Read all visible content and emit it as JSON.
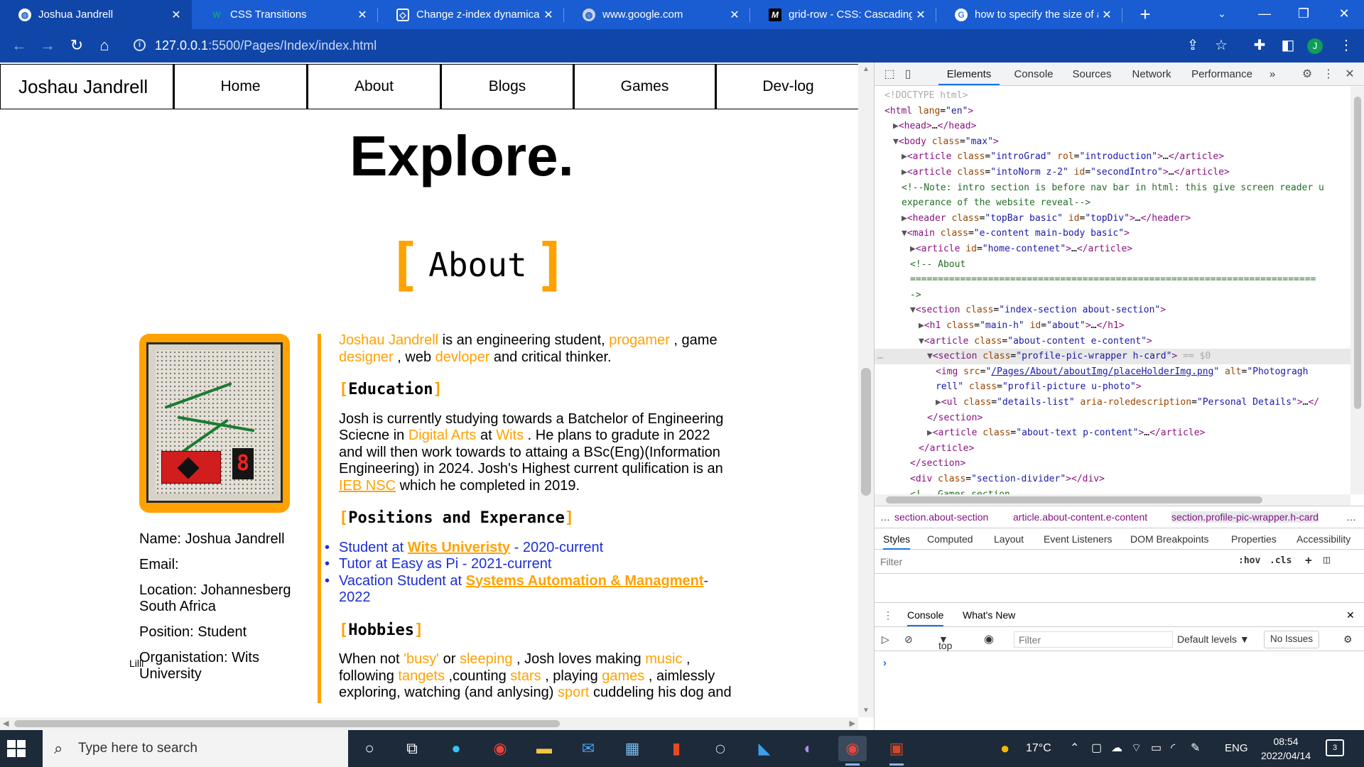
{
  "browser": {
    "tabs": [
      {
        "title": "Joshua Jandrell",
        "icon": "globe-icon",
        "active": true
      },
      {
        "title": "CSS Transitions",
        "icon": "w3schools-icon",
        "active": false
      },
      {
        "title": "Change z-index dynamically",
        "icon": "codepen-icon",
        "active": false
      },
      {
        "title": "www.google.com",
        "icon": "globe-icon",
        "active": false
      },
      {
        "title": "grid-row - CSS: Cascading S",
        "icon": "mdn-icon",
        "active": false
      },
      {
        "title": "how to specify the size of a",
        "icon": "google-icon",
        "active": false
      }
    ],
    "url_host": "127.0.0.1",
    "url_path": ":5500/Pages/Index/index.html",
    "profile_initial": "J"
  },
  "site": {
    "brand": "Joshau Jandrell",
    "nav": [
      "Home",
      "About",
      "Blogs",
      "Games",
      "Dev-log"
    ],
    "hero": "Explore.",
    "section_title": "About",
    "photo_digit": "8",
    "details": [
      "Name: Joshua Jandrell",
      "Email:",
      "Location: Johannesberg South Africa",
      "Position: Student",
      "Organistation: Wits University"
    ],
    "details_cut": "Lilli",
    "intro": {
      "name": "Joshau Jandrell",
      "t1": " is an engineering student, ",
      "w1": "progamer",
      "t2": " , game ",
      "w2": "designer",
      "t3": " , web ",
      "w3": "devloper",
      "t4": " and critical thinker."
    },
    "education_heading": "Education",
    "education": {
      "t1": "Josh is currently studying towards a Batchelor of Engineering Sciecne in ",
      "w1": "Digital Arts",
      "t2": " at ",
      "w2": "Wits",
      "t3": " . He plans to gradute in 2022 and will then work towards to attaing a BSc(Eng)(Information Engineering) in 2024. Josh's Highest current qulification is an ",
      "link": "IEB NSC",
      "t4": " which he completed in 2019."
    },
    "positions_heading": "Positions and Experance",
    "positions": [
      {
        "pre": "Student at ",
        "link": "Wits Univeristy",
        "post": " - 2020-current"
      },
      {
        "pre": "Tutor at Easy as Pi - 2021-current",
        "link": "",
        "post": ""
      },
      {
        "pre": "Vacation Student at ",
        "link": "Systems Automation & Managment",
        "post": "- 2022"
      }
    ],
    "hobbies_heading": "Hobbies",
    "hobbies": {
      "t1": "When not ",
      "w1": "'busy'",
      "t2": " or ",
      "w2": "sleeping",
      "t3": " , Josh loves making ",
      "w3": "music",
      "t4": " , following ",
      "w4": "tangets",
      "t5": " ,counting ",
      "w5": "stars",
      "t6": " , playing ",
      "w6": "games",
      "t7": " , aimlessly exploring, watching (and anlysing) ",
      "w7": "sport",
      "t8": " cuddeling his dog and"
    }
  },
  "devtools": {
    "tabs": [
      "Elements",
      "Console",
      "Sources",
      "Network",
      "Performance"
    ],
    "more": "»",
    "dom_lines": [
      {
        "i": 0,
        "tri": "",
        "html": "<span class=\"dc\">&lt;!DOCTYPE html&gt;</span>"
      },
      {
        "i": 0,
        "tri": "",
        "html": "<span class=\"tg\">&lt;html</span> <span class=\"an\">lang</span>=<span class=\"av\">\"en\"</span><span class=\"tg\">&gt;</span>"
      },
      {
        "i": 1,
        "tri": "▶",
        "html": "<span class=\"tg\">&lt;head&gt;</span>…<span class=\"tg\">&lt;/head&gt;</span>"
      },
      {
        "i": 1,
        "tri": "▼",
        "html": "<span class=\"tg\">&lt;body</span> <span class=\"an\">class</span>=<span class=\"av\">\"max\"</span><span class=\"tg\">&gt;</span>"
      },
      {
        "i": 2,
        "tri": "▶",
        "html": "<span class=\"tg\">&lt;article</span> <span class=\"an\">class</span>=<span class=\"av\">\"introGrad\"</span> <span class=\"an\">rol</span>=<span class=\"av\">\"introduction\"</span><span class=\"tg\">&gt;</span>…<span class=\"tg\">&lt;/article&gt;</span>"
      },
      {
        "i": 2,
        "tri": "▶",
        "html": "<span class=\"tg\">&lt;article</span> <span class=\"an\">class</span>=<span class=\"av\">\"intoNorm z-2\"</span> <span class=\"an\">id</span>=<span class=\"av\">\"secondIntro\"</span><span class=\"tg\">&gt;</span>…<span class=\"tg\">&lt;/article&gt;</span>"
      },
      {
        "i": 2,
        "tri": "",
        "html": "<span class=\"cm\">&lt;!--Note: intro section is before nav bar in html: this give screen reader u</span>"
      },
      {
        "i": 2,
        "tri": "",
        "html": "<span class=\"cm\">experance of the website reveal--&gt;</span>"
      },
      {
        "i": 2,
        "tri": "▶",
        "html": "<span class=\"tg\">&lt;header</span> <span class=\"an\">class</span>=<span class=\"av\">\"topBar basic\"</span> <span class=\"an\">id</span>=<span class=\"av\">\"topDiv\"</span><span class=\"tg\">&gt;</span>…<span class=\"tg\">&lt;/header&gt;</span>"
      },
      {
        "i": 2,
        "tri": "▼",
        "html": "<span class=\"tg\">&lt;main</span> <span class=\"an\">class</span>=<span class=\"av\">\"e-content main-body basic\"</span><span class=\"tg\">&gt;</span>"
      },
      {
        "i": 3,
        "tri": "▶",
        "html": "<span class=\"tg\">&lt;article</span> <span class=\"an\">id</span>=<span class=\"av\">\"home-contenet\"</span><span class=\"tg\">&gt;</span>…<span class=\"tg\">&lt;/article&gt;</span>"
      },
      {
        "i": 3,
        "tri": "",
        "html": "<span class=\"cm\">&lt;!-- About</span>"
      },
      {
        "i": 3,
        "tri": "",
        "html": "<span class=\"cm\">=========================================================================</span>"
      },
      {
        "i": 3,
        "tri": "",
        "html": "<span class=\"cm\">-&gt;</span>"
      },
      {
        "i": 3,
        "tri": "▼",
        "html": "<span class=\"tg\">&lt;section</span> <span class=\"an\">class</span>=<span class=\"av\">\"index-section about-section\"</span><span class=\"tg\">&gt;</span>"
      },
      {
        "i": 4,
        "tri": "▶",
        "html": "<span class=\"tg\">&lt;h1</span> <span class=\"an\">class</span>=<span class=\"av\">\"main-h\"</span> <span class=\"an\">id</span>=<span class=\"av\">\"about\"</span><span class=\"tg\">&gt;</span>…<span class=\"tg\">&lt;/h1&gt;</span>"
      },
      {
        "i": 4,
        "tri": "▼",
        "html": "<span class=\"tg\">&lt;article</span> <span class=\"an\">class</span>=<span class=\"av\">\"about-content e-content\"</span><span class=\"tg\">&gt;</span>"
      },
      {
        "i": 5,
        "tri": "▼",
        "sel": true,
        "html": "<span class=\"tg\">&lt;section</span> <span class=\"an\">class</span>=<span class=\"av\">\"profile-pic-wrapper h-card\"</span><span class=\"tg\">&gt;</span> <span class=\"dc\">== $0</span>"
      },
      {
        "i": 6,
        "tri": "",
        "html": "<span class=\"tg\">&lt;img</span> <span class=\"an\">src</span>=<span class=\"av\">\"<u>/Pages/About/aboutImg/placeHolderImg.png</u>\"</span> <span class=\"an\">alt</span>=<span class=\"av\">\"Photogragh</span>"
      },
      {
        "i": 6,
        "tri": "",
        "html": "<span class=\"av\">rell\"</span> <span class=\"an\">class</span>=<span class=\"av\">\"profil-picture u-photo\"</span><span class=\"tg\">&gt;</span>"
      },
      {
        "i": 6,
        "tri": "▶",
        "html": "<span class=\"tg\">&lt;ul</span> <span class=\"an\">class</span>=<span class=\"av\">\"details-list\"</span> <span class=\"an\">aria-roledescription</span>=<span class=\"av\">\"Personal Details\"</span><span class=\"tg\">&gt;</span>…<span class=\"tg\">&lt;/</span>"
      },
      {
        "i": 5,
        "tri": "",
        "html": "<span class=\"tg\">&lt;/section&gt;</span>"
      },
      {
        "i": 5,
        "tri": "▶",
        "html": "<span class=\"tg\">&lt;article</span> <span class=\"an\">class</span>=<span class=\"av\">\"about-text p-content\"</span><span class=\"tg\">&gt;</span>…<span class=\"tg\">&lt;/article&gt;</span>"
      },
      {
        "i": 4,
        "tri": "",
        "html": "<span class=\"tg\">&lt;/article&gt;</span>"
      },
      {
        "i": 3,
        "tri": "",
        "html": "<span class=\"tg\">&lt;/section&gt;</span>"
      },
      {
        "i": 3,
        "tri": "",
        "html": "<span class=\"tg\">&lt;div</span> <span class=\"an\">class</span>=<span class=\"av\">\"section-divider\"</span><span class=\"tg\">&gt;&lt;/div&gt;</span>"
      },
      {
        "i": 3,
        "tri": "",
        "html": "<span class=\"cm\">&lt;!-- Games section</span>"
      },
      {
        "i": 3,
        "tri": "",
        "html": "<span class=\"cm\">=========================================================================</span>"
      }
    ],
    "sel_marker": "…",
    "breadcrumbs": [
      "…",
      "section.about-section",
      "article.about-content.e-content",
      "section.profile-pic-wrapper.h-card",
      "…"
    ],
    "style_tabs": [
      "Styles",
      "Computed",
      "Layout",
      "Event Listeners",
      "DOM Breakpoints",
      "Properties",
      "Accessibility"
    ],
    "style_filter_placeholder": "Filter",
    "hov": ":hov",
    "cls": ".cls",
    "drawer_tabs": [
      "Console",
      "What's New"
    ],
    "console_context": "top",
    "console_filter_placeholder": "Filter",
    "levels": "Default levels ▼",
    "issues": "No Issues",
    "prompt": "›"
  },
  "taskbar": {
    "search_placeholder": "Type here to search",
    "temperature": "17°C",
    "lang": "ENG",
    "time": "08:54",
    "date": "2022/04/14",
    "notifications": "3"
  }
}
